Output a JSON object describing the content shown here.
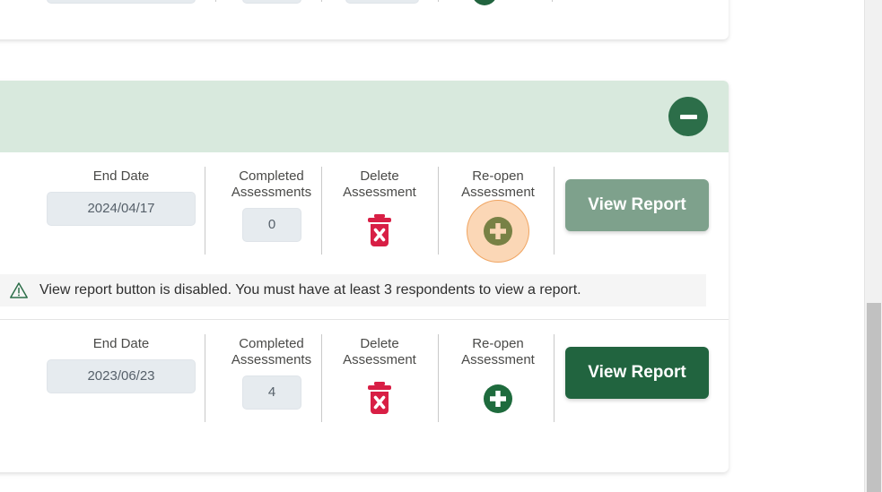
{
  "panel": {
    "collapse_icon": "minus-circle-icon",
    "header_color": "#d8e9dd",
    "collapse_button_color": "#2c6e49"
  },
  "columns": {
    "end_date": "End Date",
    "completed_assessments": "Completed\nAssessments",
    "delete_assessment": "Delete\nAssessment",
    "reopen_assessment": "Re-open\nAssessment"
  },
  "rows": [
    {
      "end_date": "2024/04/17",
      "completed_assessments": "0",
      "delete_icon": "trash-x-icon",
      "reopen_icon": "plus-circle-icon",
      "reopen_highlighted": true,
      "report_label": "View Report",
      "report_enabled": false
    },
    {
      "end_date": "2023/06/23",
      "completed_assessments": "4",
      "delete_icon": "trash-x-icon",
      "reopen_icon": "plus-circle-icon",
      "reopen_highlighted": false,
      "report_label": "View Report",
      "report_enabled": true
    }
  ],
  "warning": {
    "icon": "warning-triangle-icon",
    "text": "View report button is disabled. You must have at least 3 respondents to view a report."
  },
  "colors": {
    "accent_green": "#21643f",
    "muted_green": "#7ea18c",
    "header_green": "#d8e9dd",
    "delete_red": "#d81f45",
    "highlight_orange": "#f6a050",
    "field_grey": "#e6ebef"
  },
  "scrollbar": {
    "thumb_color": "#c1c1c1",
    "track_color": "#f1f1f1"
  }
}
